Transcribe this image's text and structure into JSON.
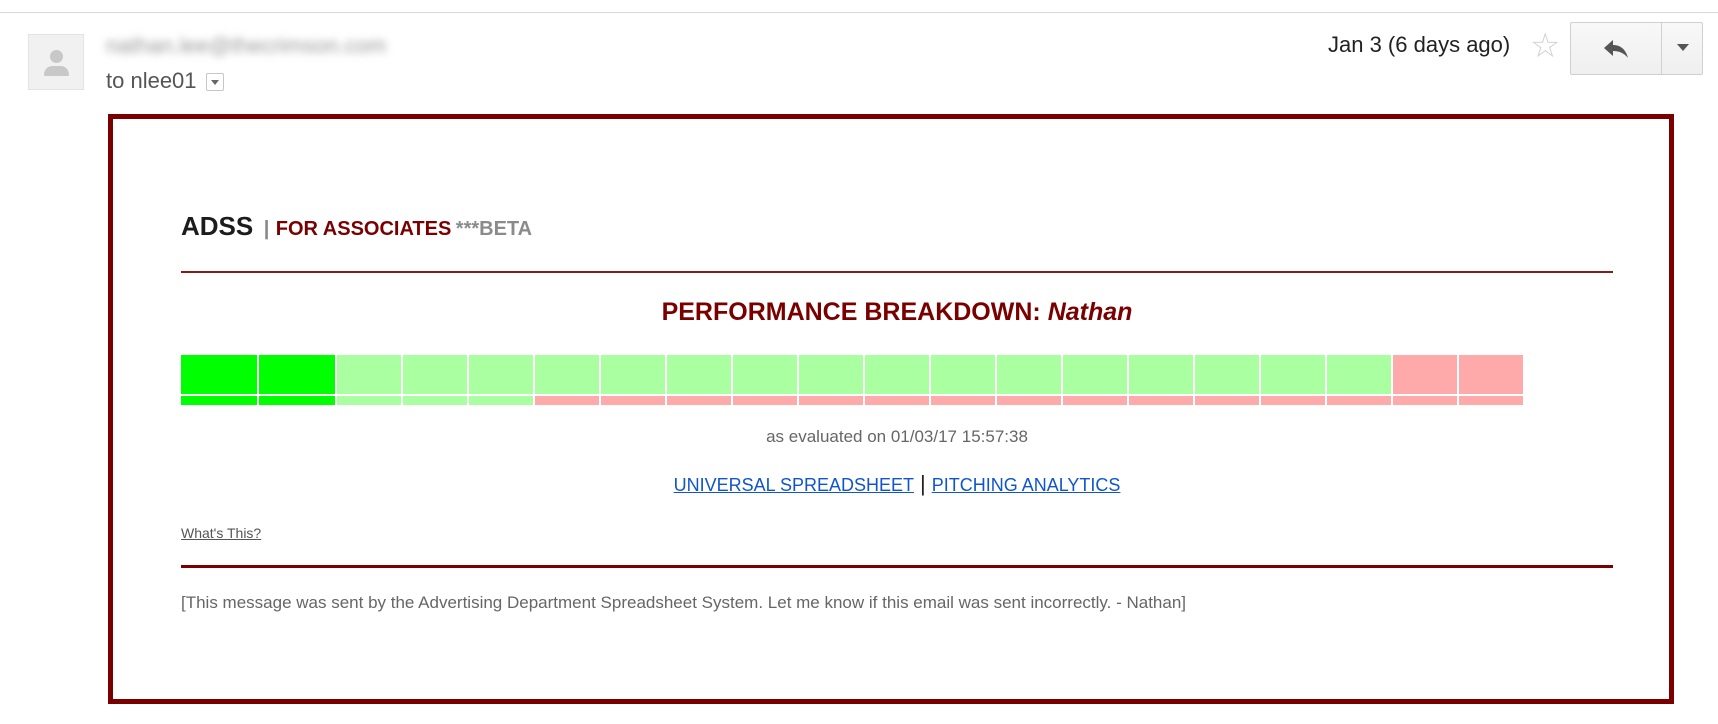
{
  "header": {
    "sender_email": "nathan.lee@thecrimson.com",
    "to_label": "to nlee01",
    "date": "Jan 3 (6 days ago)"
  },
  "icons": {
    "avatar": "person-avatar-icon",
    "recipient_dropdown": "chevron-down-icon",
    "star": "star-icon",
    "reply": "reply-arrow-icon",
    "more": "caret-down-icon"
  },
  "email": {
    "brand": "ADSS",
    "separator": "|",
    "tagline": "FOR ASSOCIATES",
    "beta": "***BETA",
    "heading_prefix": "PERFORMANCE BREAKDOWN:",
    "heading_name": "Nathan",
    "performance_segments": [
      {
        "top": "strong",
        "bottom": "strong"
      },
      {
        "top": "strong",
        "bottom": "strong"
      },
      {
        "top": "good",
        "bottom": "good"
      },
      {
        "top": "good",
        "bottom": "good"
      },
      {
        "top": "good",
        "bottom": "good"
      },
      {
        "top": "good",
        "bottom": "bad"
      },
      {
        "top": "good",
        "bottom": "bad"
      },
      {
        "top": "good",
        "bottom": "bad"
      },
      {
        "top": "good",
        "bottom": "bad"
      },
      {
        "top": "good",
        "bottom": "bad"
      },
      {
        "top": "good",
        "bottom": "bad"
      },
      {
        "top": "good",
        "bottom": "bad"
      },
      {
        "top": "good",
        "bottom": "bad"
      },
      {
        "top": "good",
        "bottom": "bad"
      },
      {
        "top": "good",
        "bottom": "bad"
      },
      {
        "top": "good",
        "bottom": "bad"
      },
      {
        "top": "good",
        "bottom": "bad"
      },
      {
        "top": "good",
        "bottom": "bad"
      },
      {
        "top": "bad",
        "bottom": "bad"
      },
      {
        "top": "bad",
        "bottom": "bad"
      }
    ],
    "segment_colors": {
      "strong": "#00ff00",
      "good": "#aaffa0",
      "bad": "#ffaaaa"
    },
    "evaluated": "as evaluated on 01/03/17 15:57:38",
    "link_spreadsheet": "UNIVERSAL SPREADSHEET",
    "link_separator": "|",
    "link_analytics": "PITCHING ANALYTICS",
    "whats_this": "What's This?",
    "footer": "[This message was sent by the Advertising Department Spreadsheet System. Let me know if this email was sent incorrectly. - Nathan]"
  },
  "colors": {
    "accent": "#7a0000",
    "link": "#1155cc"
  }
}
